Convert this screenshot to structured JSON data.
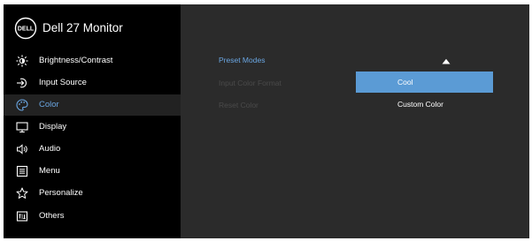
{
  "brand": {
    "logo_text": "DELL",
    "title": "Dell 27 Monitor"
  },
  "sidebar": {
    "items": [
      {
        "label": "Brightness/Contrast",
        "icon": "brightness-icon",
        "active": false
      },
      {
        "label": "Input Source",
        "icon": "input-source-icon",
        "active": false
      },
      {
        "label": "Color",
        "icon": "color-palette-icon",
        "active": true
      },
      {
        "label": "Display",
        "icon": "display-icon",
        "active": false
      },
      {
        "label": "Audio",
        "icon": "speaker-icon",
        "active": false
      },
      {
        "label": "Menu",
        "icon": "menu-icon",
        "active": false
      },
      {
        "label": "Personalize",
        "icon": "star-icon",
        "active": false
      },
      {
        "label": "Others",
        "icon": "others-icon",
        "active": false
      }
    ]
  },
  "submenu": {
    "items": [
      {
        "label": "Preset Modes",
        "state": "active"
      },
      {
        "label": "Input Color Format",
        "state": "disabled"
      },
      {
        "label": "Reset Color",
        "state": "disabled"
      }
    ]
  },
  "options": {
    "items": [
      {
        "label": "Cool",
        "selected": true
      },
      {
        "label": "Custom Color",
        "selected": false
      }
    ]
  },
  "colors": {
    "accent": "#6aa6e2",
    "selected_background": "#5b9bd5",
    "panel_background": "#2b2b2b",
    "sidebar_background": "#000000"
  }
}
